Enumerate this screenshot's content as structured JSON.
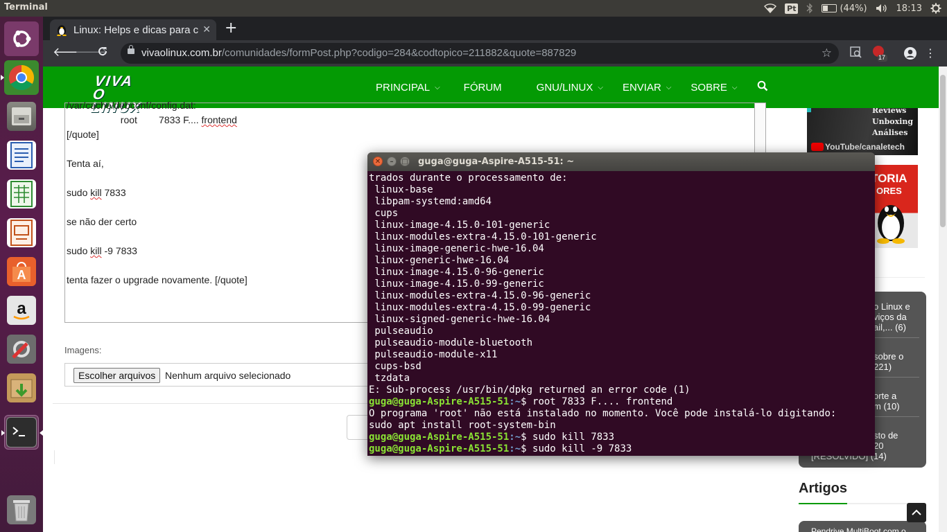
{
  "panel": {
    "app_name": "Terminal",
    "keyboard_layout": "Pt",
    "battery": "(44%)",
    "clock": "18:13"
  },
  "launcher": {
    "items": [
      "ubuntu-dash",
      "chrome",
      "files",
      "writer",
      "calc",
      "impress",
      "software",
      "amazon",
      "settings",
      "updates",
      "terminal",
      "trash"
    ]
  },
  "browser": {
    "tab_title": "Linux: Helps e dicas para c",
    "url_host": "vivaolinux.com.br",
    "url_path": "/comunidades/formPost.php?codigo=284&codtopico=211882&quote=887829",
    "ext_badge": "17"
  },
  "site": {
    "logo": "VIVA O LINUX",
    "nav": [
      "PRINCIPAL",
      "FÓRUM",
      "GNU/LINUX",
      "ENVIAR",
      "SOBRE"
    ],
    "textarea_lines": [
      "/var/cache/debconf/config.dat:",
      "                    root        7833 F.... frontend",
      "[/quote]",
      "",
      "Tenta aí,",
      "",
      "sudo kill 7833",
      "",
      "se não der certo",
      "",
      "sudo kill -9 7833",
      "",
      "tenta fazer o upgrade novamente. [/quote]"
    ],
    "images_label": "Imagens:",
    "file_button": "Escolher arquivos",
    "file_status": "Nenhum arquivo selecionado"
  },
  "sidebar": {
    "ad1_lines": [
      "Reviews",
      "Unboxing",
      "Análises"
    ],
    "ad1_channel": "/canaletech",
    "ad2_line1": "TORIA",
    "ad2_line2": "ORES",
    "topics": [
      [
        "o Linux e",
        "viços da",
        "ail,... (6)"
      ],
      [
        "sobre o",
        "221)"
      ],
      [
        "orte a",
        "m (10)"
      ],
      [
        "sto de",
        "20",
        "[RESOLVIDO] (14)"
      ]
    ],
    "artigos_heading": "Artigos",
    "article_preview": "Pendrive MultiBoot com o"
  },
  "terminal": {
    "title": "guga@guga-Aspire-A515-51: ~",
    "prompt_user": "guga@guga-Aspire-A515-51",
    "prompt_path": ":~",
    "lines": [
      {
        "t": "out",
        "text": "trados durante o processamento de:"
      },
      {
        "t": "out",
        "text": " linux-base"
      },
      {
        "t": "out",
        "text": " libpam-systemd:amd64"
      },
      {
        "t": "out",
        "text": " cups"
      },
      {
        "t": "out",
        "text": " linux-image-4.15.0-101-generic"
      },
      {
        "t": "out",
        "text": " linux-modules-extra-4.15.0-101-generic"
      },
      {
        "t": "out",
        "text": " linux-image-generic-hwe-16.04"
      },
      {
        "t": "out",
        "text": " linux-generic-hwe-16.04"
      },
      {
        "t": "out",
        "text": " linux-image-4.15.0-96-generic"
      },
      {
        "t": "out",
        "text": " linux-image-4.15.0-99-generic"
      },
      {
        "t": "out",
        "text": " linux-modules-extra-4.15.0-96-generic"
      },
      {
        "t": "out",
        "text": " linux-modules-extra-4.15.0-99-generic"
      },
      {
        "t": "out",
        "text": " linux-signed-generic-hwe-16.04"
      },
      {
        "t": "out",
        "text": " pulseaudio"
      },
      {
        "t": "out",
        "text": " pulseaudio-module-bluetooth"
      },
      {
        "t": "out",
        "text": " pulseaudio-module-x11"
      },
      {
        "t": "out",
        "text": " cups-bsd"
      },
      {
        "t": "out",
        "text": " tzdata"
      },
      {
        "t": "out",
        "text": "E: Sub-process /usr/bin/dpkg returned an error code (1)"
      },
      {
        "t": "cmd",
        "text": "$ root 7833 F.... frontend"
      },
      {
        "t": "out",
        "text": "O programa 'root' não está instalado no momento. Você pode instalá-lo digitando:"
      },
      {
        "t": "out",
        "text": "sudo apt install root-system-bin"
      },
      {
        "t": "cmd",
        "text": "$ sudo kill 7833"
      },
      {
        "t": "cmd",
        "text": "$ sudo kill -9 7833"
      }
    ]
  },
  "colors": {
    "site_green": "#049a04",
    "terminal_bg": "#300a24",
    "prompt_green": "#8ae234",
    "prompt_blue": "#729fcf"
  }
}
